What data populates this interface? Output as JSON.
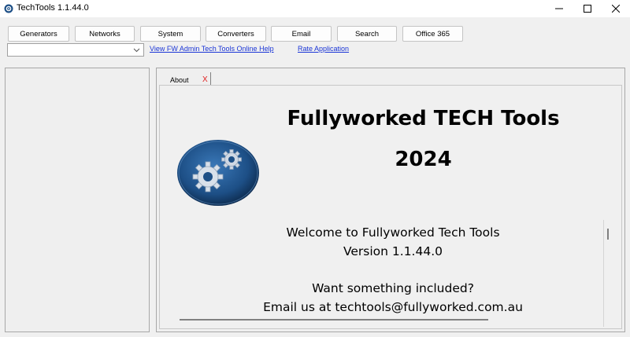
{
  "window": {
    "title": "TechTools 1.1.44.0",
    "controls": {
      "minimize": "—",
      "maximize": "☐",
      "close": "✕"
    }
  },
  "toolbar": {
    "buttons": [
      "Generators",
      "Networks",
      "System",
      "Converters",
      "Email",
      "Search",
      "Office 365"
    ],
    "combo_value": "",
    "links": {
      "help": "View FW Admin Tech Tools Online Help",
      "rate": "Rate Application"
    }
  },
  "tabs": [
    {
      "label": "About",
      "close": "X"
    }
  ],
  "about": {
    "title": "Fullyworked TECH Tools",
    "year": "2024",
    "welcome": "Welcome to Fullyworked Tech Tools",
    "version": "Version 1.1.44.0",
    "want": "Want something included?",
    "email": "Email us at techtools@fullyworked.com.au",
    "logo_icon": "gears-icon"
  },
  "colors": {
    "link": "#1a35d6",
    "tab_close": "#e02020",
    "logo_blue": "#1d4f86"
  }
}
